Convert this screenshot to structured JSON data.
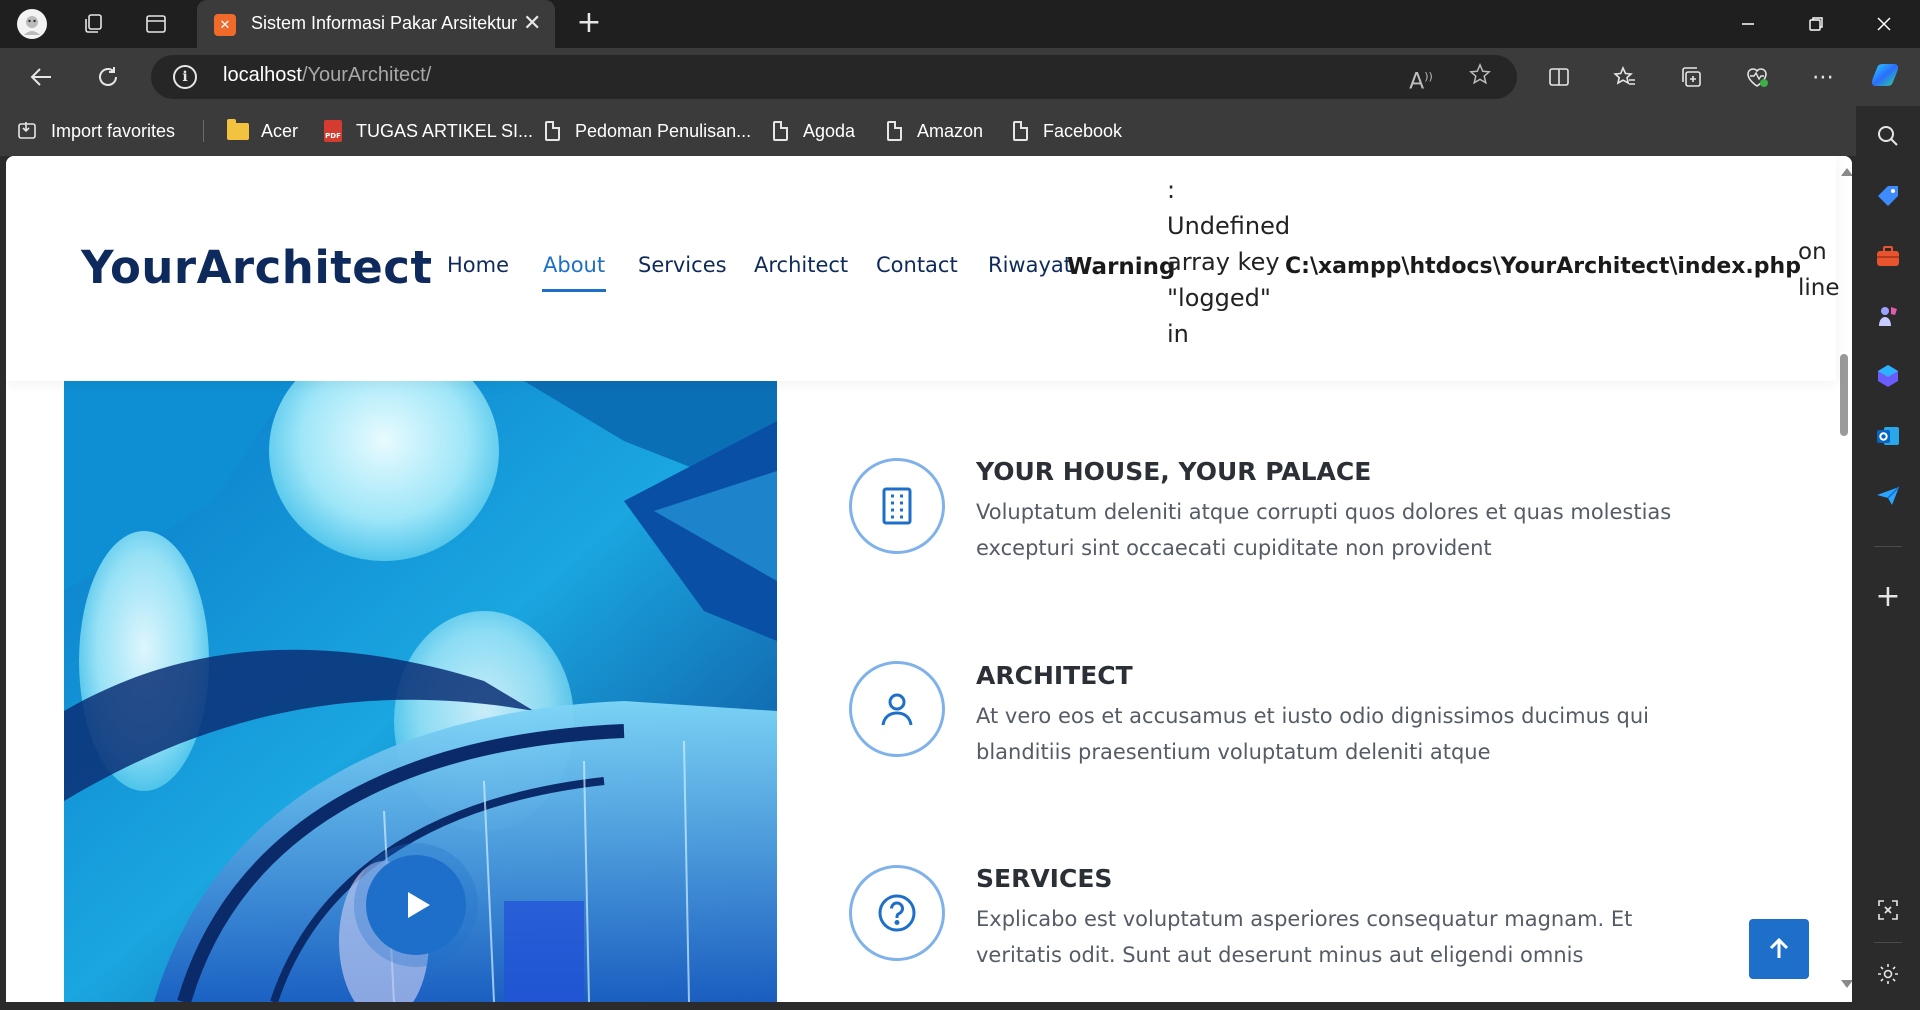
{
  "browser": {
    "tab": {
      "title": "Sistem Informasi Pakar Arsitektur",
      "favicon": "xampp-icon"
    },
    "address": {
      "host": "localhost",
      "path": "/YourArchitect/"
    },
    "bookmarks": [
      {
        "label": "Import favorites",
        "icon": "import-icon"
      },
      {
        "label": "Acer",
        "icon": "folder-icon"
      },
      {
        "label": "TUGAS ARTIKEL SI...",
        "icon": "pdf-icon"
      },
      {
        "label": "Pedoman Penulisan...",
        "icon": "page-icon"
      },
      {
        "label": "Agoda",
        "icon": "page-icon"
      },
      {
        "label": "Amazon",
        "icon": "page-icon"
      },
      {
        "label": "Facebook",
        "icon": "page-icon"
      }
    ],
    "pdf_badge": "PDF"
  },
  "site": {
    "logo": "YourArchitect",
    "nav": [
      "Home",
      "About",
      "Services",
      "Architect",
      "Contact",
      "Riwayat"
    ],
    "active_nav": "About",
    "warning": {
      "label": "Warning",
      "colon": ":",
      "message_lines": [
        "Undefined",
        "array key",
        "\"logged\"",
        "in"
      ],
      "file": "C:\\xampp\\htdocs\\YourArchitect\\index.php",
      "tail_lines": [
        "on",
        "line"
      ]
    },
    "features": [
      {
        "title": "YOUR HOUSE, YOUR PALACE",
        "icon": "building-icon",
        "desc": "Voluptatum deleniti atque corrupti quos dolores et quas molestias excepturi sint occaecati cupiditate non provident"
      },
      {
        "title": "ARCHITECT",
        "icon": "user-icon",
        "desc": "At vero eos et accusamus et iusto odio dignissimos ducimus qui blanditiis praesentium voluptatum deleniti atque"
      },
      {
        "title": "SERVICES",
        "icon": "help-circle-icon",
        "desc": "Explicabo est voluptatum asperiores consequatur magnam. Et veritatis odit. Sunt aut deserunt minus aut eligendi omnis"
      }
    ]
  },
  "colors": {
    "brand": "#0e2a5c",
    "accent": "#1e6fc9",
    "icon_ring": "#7fb2ea"
  }
}
